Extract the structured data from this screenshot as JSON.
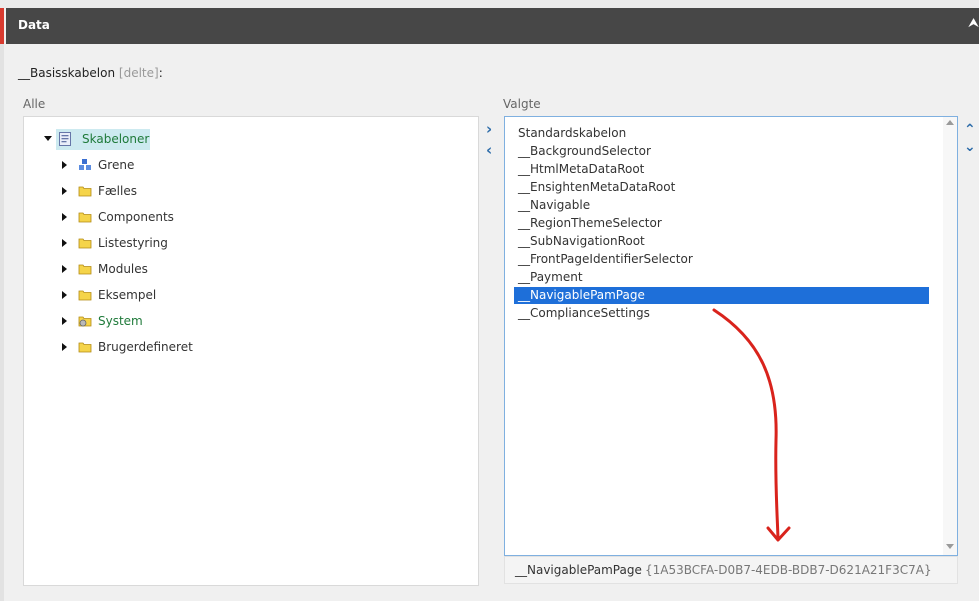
{
  "header": {
    "title": "Data",
    "collapse_icon": "chevron-double-up-icon"
  },
  "field": {
    "label": "__Basisskabelon",
    "share_label": "[delte]",
    "suffix": ":"
  },
  "left": {
    "label": "Alle",
    "root": {
      "label": "Skabeloner",
      "icon": "template-icon",
      "color": "#1f7a3a"
    },
    "items": [
      {
        "label": "Grene",
        "icon": "branch-icon",
        "color": "#333333"
      },
      {
        "label": "Fælles",
        "icon": "folder-icon",
        "color": "#333333"
      },
      {
        "label": "Components",
        "icon": "folder-icon",
        "color": "#333333"
      },
      {
        "label": "Listestyring",
        "icon": "folder-icon",
        "color": "#333333"
      },
      {
        "label": "Modules",
        "icon": "folder-icon",
        "color": "#333333"
      },
      {
        "label": "Eksempel",
        "icon": "folder-icon",
        "color": "#333333"
      },
      {
        "label": "System",
        "icon": "system-folder-icon",
        "color": "#1f7a3a"
      },
      {
        "label": "Brugerdefineret",
        "icon": "folder-icon",
        "color": "#333333"
      }
    ]
  },
  "right": {
    "label": "Valgte",
    "items": [
      "Standardskabelon",
      "__BackgroundSelector",
      "__HtmlMetaDataRoot",
      "__EnsightenMetaDataRoot",
      "__Navigable",
      "__RegionThemeSelector",
      "__SubNavigationRoot",
      "__FrontPageIdentifierSelector",
      "__Payment",
      "__NavigablePamPage",
      "__ComplianceSettings"
    ],
    "selected_index": 9
  },
  "info": {
    "name": "__NavigablePamPage",
    "id": "{1A53BCFA-D0B7-4EDB-BDB7-D621A21F3C7A}"
  },
  "colors": {
    "accent": "#d83a2f",
    "header_bg": "#474747",
    "selection": "#1e6fd9",
    "arrow": "#2d6ca9",
    "annotation": "#d9231c"
  }
}
